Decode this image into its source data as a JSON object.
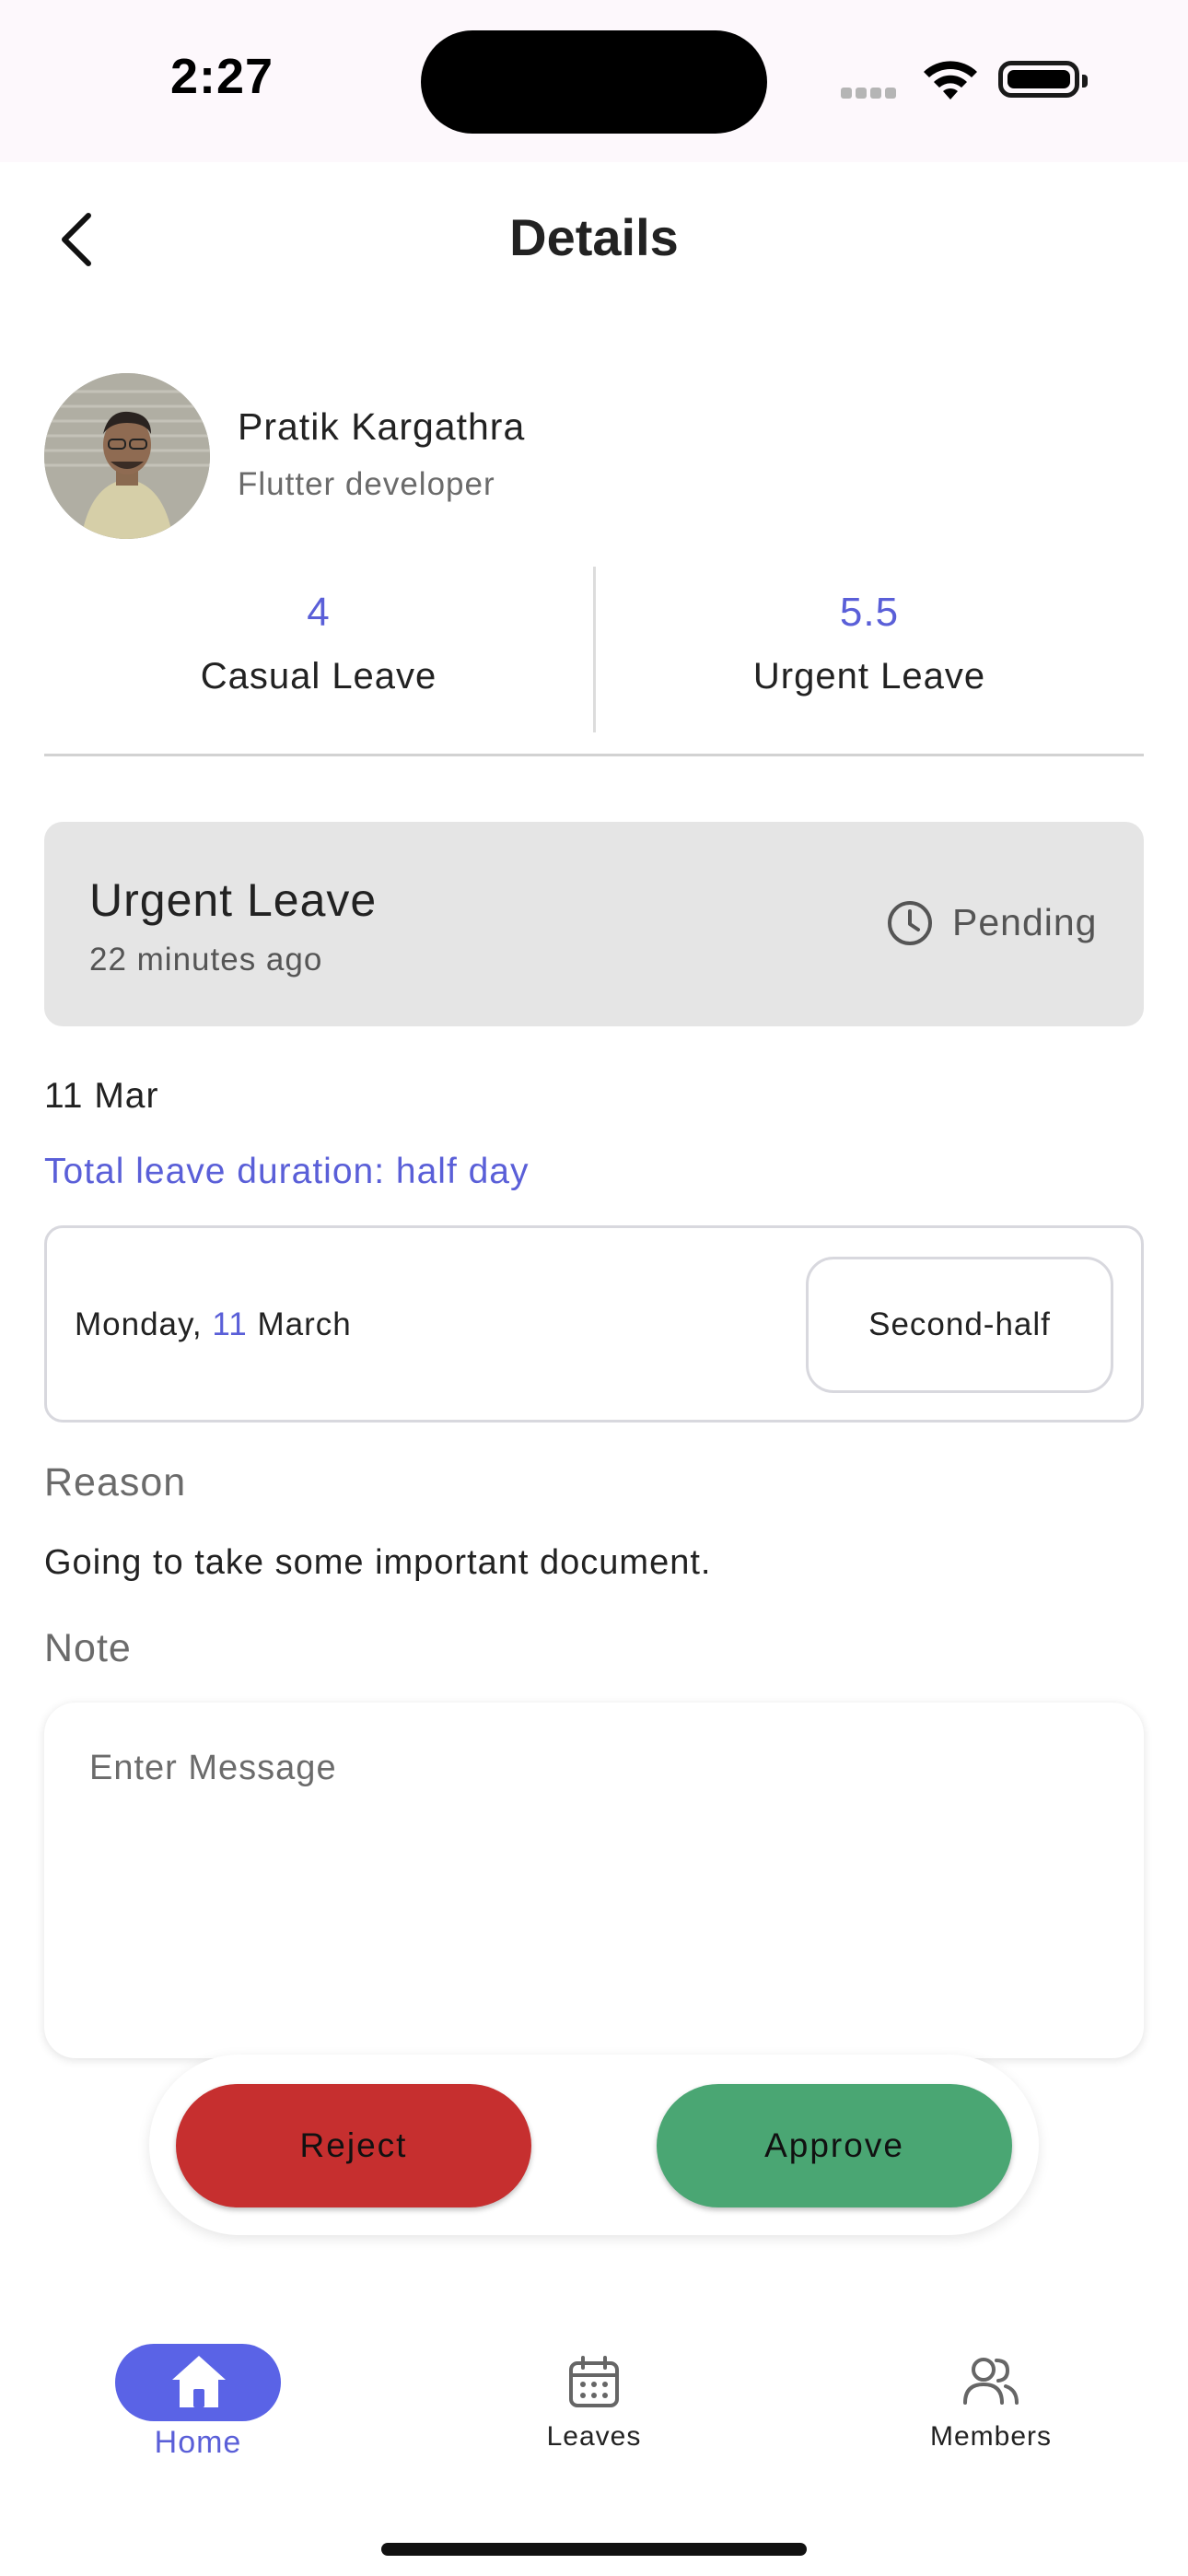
{
  "status_bar": {
    "time": "2:27"
  },
  "header": {
    "title": "Details",
    "back_icon": "chevron-left-icon"
  },
  "employee": {
    "name": "Pratik Kargathra",
    "role": "Flutter developer"
  },
  "balances": [
    {
      "value": "4",
      "label": "Casual Leave"
    },
    {
      "value": "5.5",
      "label": "Urgent Leave"
    }
  ],
  "leave": {
    "type": "Urgent Leave",
    "requested": "22 minutes ago",
    "status": "Pending",
    "status_icon": "clock-icon",
    "date": "11 Mar",
    "duration": "Total leave duration: half day",
    "day": {
      "weekday": "Monday,",
      "day_number": "11",
      "month": "March",
      "half": "Second-half"
    }
  },
  "reason": {
    "label": "Reason",
    "text": "Going to take some important document."
  },
  "note": {
    "label": "Note",
    "placeholder": "Enter Message"
  },
  "actions": {
    "reject": "Reject",
    "approve": "Approve"
  },
  "nav": {
    "home": "Home",
    "leaves": "Leaves",
    "members": "Members",
    "active": "Home"
  },
  "colors": {
    "accent": "#5a5fd8",
    "reject": "#c62f2f",
    "approve": "#4aa673",
    "card": "#e5e5e5"
  }
}
